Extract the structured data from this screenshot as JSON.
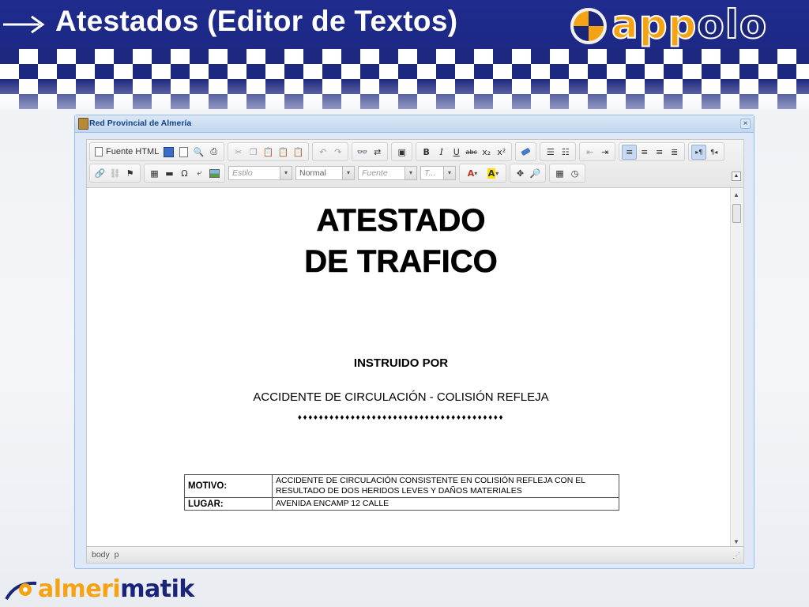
{
  "header": {
    "title": "Atestados (Editor de Textos)",
    "brand": "appolo"
  },
  "window": {
    "title": "Red Provincial de Almería",
    "close_symbol": "×"
  },
  "toolbar": {
    "source_label": "Fuente HTML",
    "combos": {
      "style": "Estilo",
      "format": "Normal",
      "font": "Fuente",
      "size": "T..."
    },
    "glyphs": {
      "bold": "B",
      "italic": "I",
      "underline": "U",
      "strike": "abc",
      "subscript": "x₂",
      "superscript": "x²",
      "omega": "Ω",
      "text_color": "A",
      "bg_color": "A",
      "ltr": "▸¶",
      "rtl": "¶◂",
      "dropdown": "▾"
    }
  },
  "document": {
    "title_line1": "ATESTADO",
    "title_line2": "DE TRAFICO",
    "instructed_by": "INSTRUIDO POR",
    "subtitle": "ACCIDENTE DE CIRCULACIÓN - COLISIÓN REFLEJA",
    "divider": "♦♦♦♦♦♦♦♦♦♦♦♦♦♦♦♦♦♦♦♦♦♦♦♦♦♦♦♦♦♦♦♦♦♦♦♦♦♦♦",
    "table": [
      {
        "label": "MOTIVO:",
        "value": "ACCIDENTE DE CIRCULACIÓN CONSISTENTE EN COLISIÓN REFLEJA CON EL RESULTADO DE DOS HERIDOS LEVES Y DAÑOS MATERIALES"
      },
      {
        "label": "LUGAR:",
        "value": "AVENIDA ENCAMP 12 CALLE"
      }
    ]
  },
  "statusbar": {
    "path": "body  p"
  },
  "footer": {
    "brand_part1": "almeri",
    "brand_part2": "matik"
  },
  "colors": {
    "header_blue": "#1a2478",
    "brand_orange": "#f6a313",
    "window_blue": "#99bbe8"
  }
}
